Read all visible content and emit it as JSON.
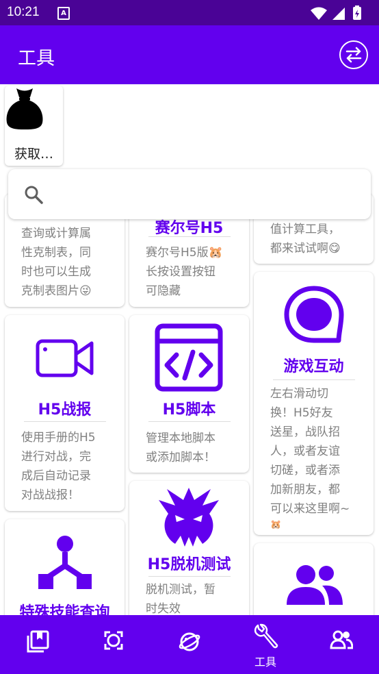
{
  "status_bar": {
    "time": "10:21",
    "notification_icon": "a-icon"
  },
  "app_bar": {
    "title": "工具",
    "action_icon": "swap-icon"
  },
  "quick_item": {
    "label": "获取…",
    "icon": "money-bag-icon"
  },
  "search": {
    "placeholder": "",
    "icon": "search-icon"
  },
  "cards": [
    {
      "id": "type-chart",
      "title": "",
      "desc": [
        "查询或计算属",
        "性克制表，同",
        "时也可以生成",
        "克制表图片😜"
      ]
    },
    {
      "id": "seer-h5",
      "title": "赛尔号H5",
      "desc": [
        "赛尔号H5版🐹",
        "长按设置按钮",
        "可隐藏"
      ]
    },
    {
      "id": "calc",
      "title": "",
      "desc": [
        "值计算工具，",
        "都来试试啊😋"
      ]
    },
    {
      "id": "h5-battle-report",
      "title": "H5战报",
      "icon": "video-camera-icon",
      "desc": [
        "使用手册的H5",
        "进行对战，完",
        "成后自动记录",
        "对战战报！"
      ]
    },
    {
      "id": "h5-script",
      "title": "H5脚本",
      "icon": "code-window-icon",
      "desc": [
        "管理本地脚本",
        "或添加脚本！"
      ]
    },
    {
      "id": "game-interact",
      "title": "游戏互动",
      "icon": "chat-bubble-icon",
      "desc": [
        "左右滑动切",
        "换！H5好友",
        "送星，战队招",
        "人，或者友谊",
        "切磋，或者添",
        "加新朋友，都",
        "可以来这里啊~",
        "🐹"
      ]
    },
    {
      "id": "special-skill",
      "title": "特殊技能查询",
      "icon": "branch-icon",
      "desc": []
    },
    {
      "id": "h5-offline",
      "title": "H5脱机测试",
      "icon": "monster-icon",
      "desc": [
        "脱机测试，暂",
        "时失效"
      ]
    },
    {
      "id": "people",
      "title": "",
      "icon": "people-icon",
      "desc": []
    }
  ],
  "bottom_nav": [
    {
      "icon": "book-icon",
      "label": ""
    },
    {
      "icon": "capture-icon",
      "label": ""
    },
    {
      "icon": "planet-icon",
      "label": ""
    },
    {
      "icon": "wrench-icon",
      "label": "工具",
      "active": true
    },
    {
      "icon": "group-icon",
      "label": ""
    }
  ],
  "colors": {
    "primary": "#6200ee",
    "status_bar": "#4a0396",
    "text_secondary": "#808080"
  }
}
